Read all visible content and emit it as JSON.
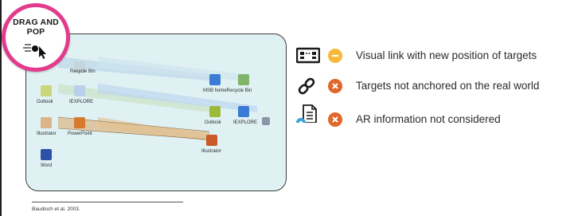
{
  "badge": {
    "title": "DRAG AND POP",
    "icon": "drag-and-pop-cursor-icon",
    "color": "#e33b8c"
  },
  "desktop": {
    "icons": [
      {
        "label": "",
        "icon": "my-computer-icon",
        "color": "#8aa0b8"
      },
      {
        "label": "Recycle Bin",
        "icon": "recycle-bin-icon",
        "color": "#c8d4dc"
      },
      {
        "label": "Outlook",
        "icon": "outlook-icon",
        "color": "#c9d77a"
      },
      {
        "label": "IEXPLORE",
        "icon": "internet-explorer-icon",
        "color": "#5b8fd6"
      },
      {
        "label": "Illustrator",
        "icon": "illustrator-icon",
        "color": "#d89a58"
      },
      {
        "label": "PowerPoint",
        "icon": "powerpoint-icon",
        "color": "#d67a2e"
      },
      {
        "label": "Word",
        "icon": "word-icon",
        "color": "#2c4fa8"
      },
      {
        "label": "MSB homeRecycle Bin",
        "icon": "recycle-bin-icon",
        "color": "#7fb46a"
      },
      {
        "label": "Outlook",
        "icon": "outlook-icon",
        "color": "#9dbb3a"
      },
      {
        "label": "IEXPLORE",
        "icon": "internet-explorer-icon",
        "color": "#3a7bd5"
      },
      {
        "label": "Illustrator",
        "icon": "illustrator-icon",
        "color": "#c85a2a"
      },
      {
        "label": "",
        "icon": "pen-tablet-icon",
        "color": "#8a96a6"
      }
    ]
  },
  "citation": "Baudisch et al. 2003.",
  "criteria": [
    {
      "icon": "visual-link-icon",
      "status": "partial",
      "status_color": "#f6b93b",
      "text": "Visual link with new position of targets"
    },
    {
      "icon": "link-icon",
      "status": "not-met",
      "status_color": "#e0672a",
      "text": "Targets not anchored on the real world"
    },
    {
      "icon": "ar-document-location-icon",
      "status": "not-met",
      "status_color": "#e0672a",
      "text": "AR information not considered"
    }
  ]
}
